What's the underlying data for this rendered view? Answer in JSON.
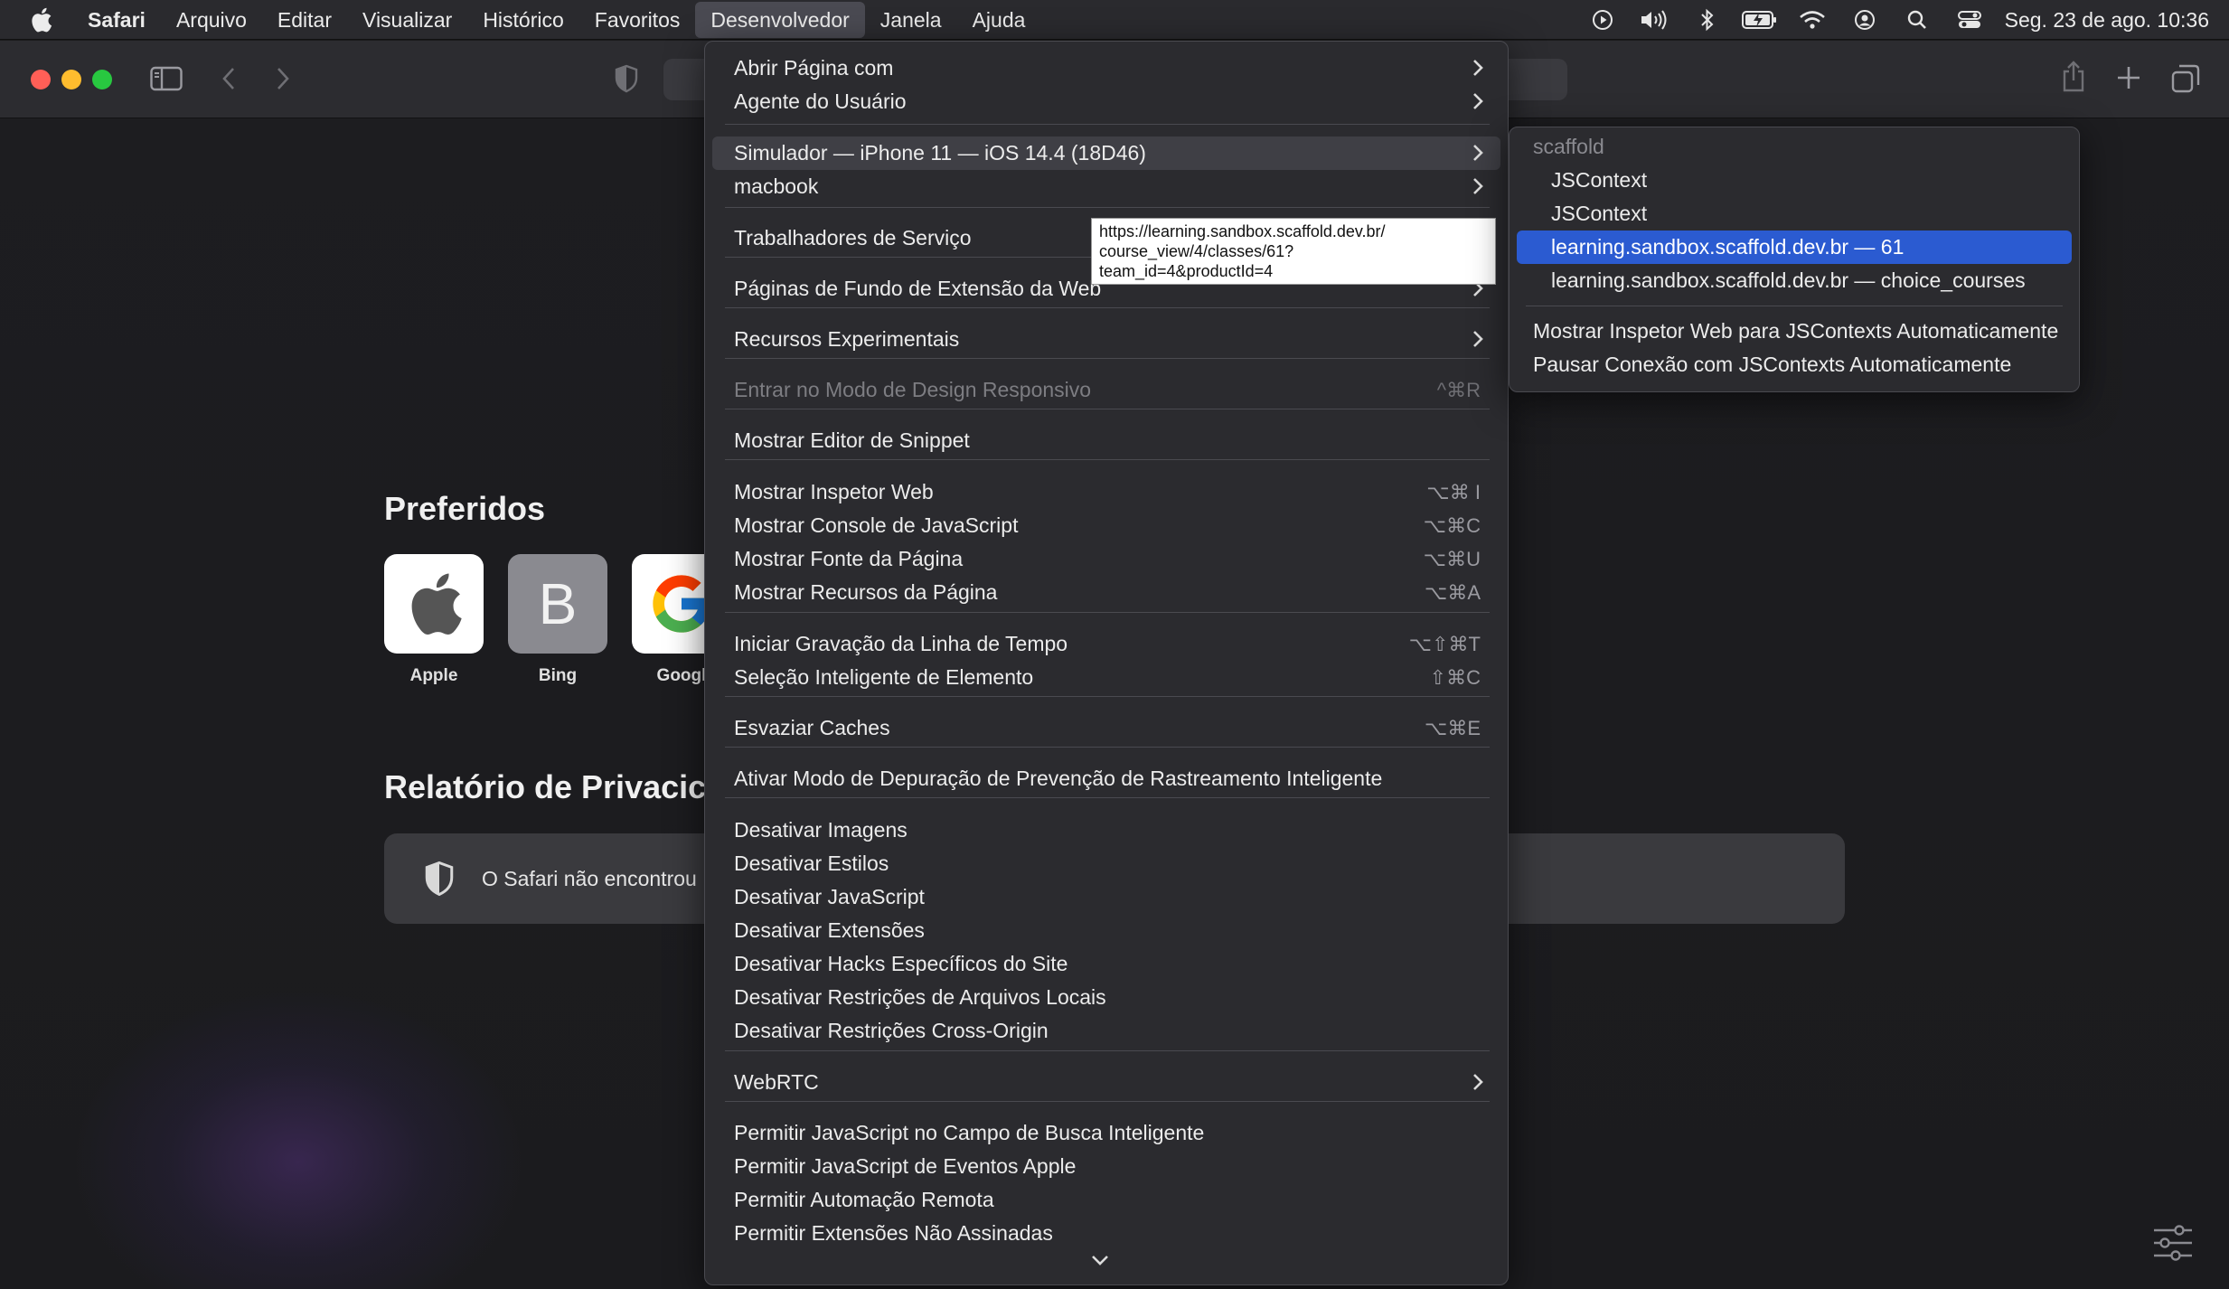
{
  "menubar": {
    "items": [
      {
        "label": "Safari",
        "bold": true
      },
      {
        "label": "Arquivo"
      },
      {
        "label": "Editar"
      },
      {
        "label": "Visualizar"
      },
      {
        "label": "Histórico"
      },
      {
        "label": "Favoritos"
      },
      {
        "label": "Desenvolvedor",
        "active": true
      },
      {
        "label": "Janela"
      },
      {
        "label": "Ajuda"
      }
    ],
    "clock": "Seg. 23 de ago.  10:36",
    "status_icons": [
      "play-circle-icon",
      "speaker-icon",
      "bluetooth-icon",
      "battery-charging-icon",
      "wifi-icon",
      "user-icon",
      "search-icon",
      "control-center-icon"
    ]
  },
  "startpage": {
    "favorites_title": "Preferidos",
    "favorites": [
      {
        "label": "Apple",
        "icon": "apple-logo-icon"
      },
      {
        "label": "Bing",
        "glyph": "B"
      },
      {
        "label": "Googl",
        "icon": "google-logo-icon"
      }
    ],
    "privacy_title": "Relatório de Privacic",
    "privacy_text": "O Safari não encontrou"
  },
  "develop_menu": {
    "items": [
      {
        "label": "Abrir Página com",
        "submenu": true
      },
      {
        "label": "Agente do Usuário",
        "submenu": true
      },
      {
        "label": "Simulador — iPhone 11 — iOS 14.4 (18D46)",
        "submenu": true,
        "highlight": true
      },
      {
        "label": "macbook",
        "submenu": true
      },
      {
        "label": "Trabalhadores de Serviço",
        "submenu": true
      },
      {
        "label": "Páginas de Fundo de Extensão da Web",
        "submenu": true
      },
      {
        "label": "Recursos Experimentais",
        "submenu": true
      },
      {
        "label": "Entrar no Modo de Design Responsivo",
        "shortcut": "^⌘R",
        "disabled": true
      },
      {
        "label": "Mostrar Editor de Snippet"
      },
      {
        "label": "Mostrar Inspetor Web",
        "shortcut": "⌥⌘ I"
      },
      {
        "label": "Mostrar Console de JavaScript",
        "shortcut": "⌥⌘C"
      },
      {
        "label": "Mostrar Fonte da Página",
        "shortcut": "⌥⌘U"
      },
      {
        "label": "Mostrar Recursos da Página",
        "shortcut": "⌥⌘A"
      },
      {
        "label": "Iniciar Gravação da Linha de Tempo",
        "shortcut": "⌥⇧⌘T"
      },
      {
        "label": "Seleção Inteligente de Elemento",
        "shortcut": "⇧⌘C"
      },
      {
        "label": "Esvaziar Caches",
        "shortcut": "⌥⌘E"
      },
      {
        "label": "Ativar Modo de Depuração de Prevenção de Rastreamento Inteligente"
      },
      {
        "label": "Desativar Imagens"
      },
      {
        "label": "Desativar Estilos"
      },
      {
        "label": "Desativar JavaScript"
      },
      {
        "label": "Desativar Extensões"
      },
      {
        "label": "Desativar Hacks Específicos do Site"
      },
      {
        "label": "Desativar Restrições de Arquivos Locais"
      },
      {
        "label": "Desativar Restrições Cross-Origin"
      },
      {
        "label": "WebRTC",
        "submenu": true
      },
      {
        "label": "Permitir JavaScript no Campo de Busca Inteligente"
      },
      {
        "label": "Permitir JavaScript de Eventos Apple"
      },
      {
        "label": "Permitir Automação Remota"
      },
      {
        "label": "Permitir Extensões Não Assinadas"
      }
    ]
  },
  "tooltip": {
    "lines": [
      "https://learning.sandbox.scaffold.dev.br/",
      "course_view/4/classes/61?",
      "team_id=4&productId=4"
    ]
  },
  "simulator_submenu": {
    "header": "scaffold",
    "items": [
      {
        "label": "JSContext"
      },
      {
        "label": "JSContext"
      },
      {
        "label": "learning.sandbox.scaffold.dev.br — 61",
        "selected": true
      },
      {
        "label": "learning.sandbox.scaffold.dev.br — choice_courses"
      }
    ],
    "actions": [
      {
        "label": "Mostrar Inspetor Web para JSContexts Automaticamente"
      },
      {
        "label": "Pausar Conexão com JSContexts Automaticamente"
      }
    ]
  },
  "colors": {
    "selection_blue": "#2b5bd1",
    "menu_bg": "#2b2b2f"
  }
}
